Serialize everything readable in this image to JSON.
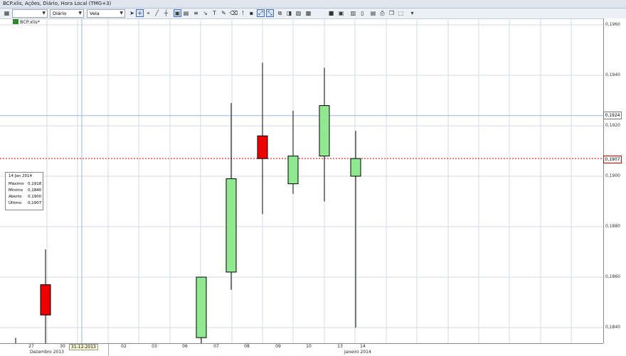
{
  "window": {
    "title": "BCP.xlis, Ações, Diário, Hora Local (TMG+3)"
  },
  "toolbar": {
    "period_value": "Diário",
    "chart_type_value": "Vela"
  },
  "tab": {
    "label": "BCP.xlis*"
  },
  "price_axis": {
    "labels": [
      "0,1960",
      "0,1940",
      "0,1920",
      "0,1900",
      "0,1880",
      "0,1860",
      "0,1840"
    ],
    "current_price": "0,1907",
    "crosshair_price": "0,1924"
  },
  "info_panel": {
    "date": "14 Jan 2014",
    "rows": [
      {
        "label": "Máximo",
        "value": "0,1918"
      },
      {
        "label": "Mínimo",
        "value": "0,1840"
      },
      {
        "label": "Aberto",
        "value": "0,1900"
      },
      {
        "label": "Último",
        "value": "0,1907"
      }
    ]
  },
  "x_axis": {
    "day_labels": [
      "27",
      "30",
      "02",
      "03",
      "06",
      "07",
      "08",
      "09",
      "10",
      "13",
      "14"
    ],
    "crosshair_date": "31-12-2013",
    "month_labels": [
      "Dezembro 2013",
      "Janeiro 2014"
    ]
  },
  "colors": {
    "up": "#90e890",
    "down": "#ee0000",
    "current_line": "#d00000",
    "crosshair": "#9db8d8"
  },
  "chart_data": {
    "type": "candlestick",
    "ylim": [
      0.183,
      0.1966
    ],
    "candles": [
      {
        "date": "27",
        "open": 0.1857,
        "high": 0.1871,
        "low": 0.183,
        "close": 0.1845,
        "dir": "down"
      },
      {
        "date": "07",
        "open": 0.1836,
        "high": 0.186,
        "low": 0.183,
        "close": 0.186,
        "dir": "up"
      },
      {
        "date": "08",
        "open": 0.1862,
        "high": 0.1929,
        "low": 0.1855,
        "close": 0.1899,
        "dir": "up"
      },
      {
        "date": "09",
        "open": 0.1916,
        "high": 0.1945,
        "low": 0.1885,
        "close": 0.1907,
        "dir": "down"
      },
      {
        "date": "10",
        "open": 0.1897,
        "high": 0.1926,
        "low": 0.1893,
        "close": 0.1908,
        "dir": "up"
      },
      {
        "date": "13",
        "open": 0.1908,
        "high": 0.1943,
        "low": 0.189,
        "close": 0.1928,
        "dir": "up"
      },
      {
        "date": "14",
        "open": 0.19,
        "high": 0.1918,
        "low": 0.184,
        "close": 0.1907,
        "dir": "up"
      }
    ]
  }
}
